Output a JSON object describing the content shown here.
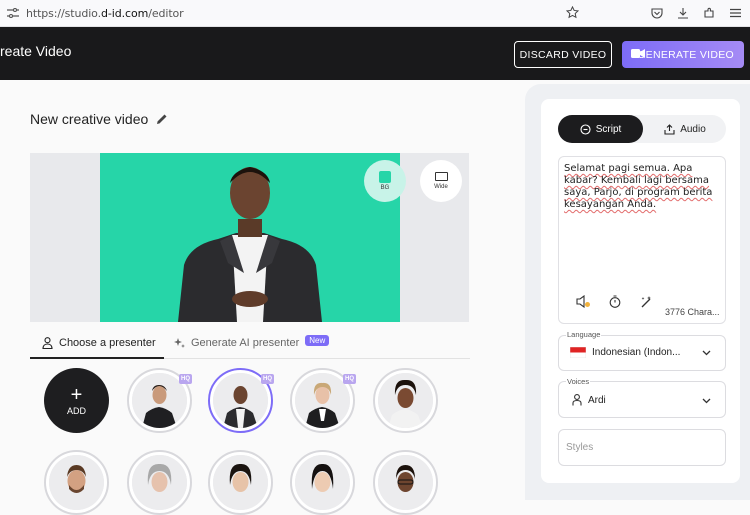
{
  "browser": {
    "url_prefix": "https://studio.",
    "url_host": "d-id.com",
    "url_path": "/editor"
  },
  "header": {
    "title": "reate Video",
    "discard_label": "DISCARD VIDEO",
    "generate_label": "GENERATE VIDEO"
  },
  "editor": {
    "video_title": "New creative video",
    "bg_label": "BG",
    "wide_label": "Wide"
  },
  "presenter_tabs": {
    "choose_label": "Choose a presenter",
    "ai_label": "Generate AI presenter",
    "new_badge": "New"
  },
  "presenters": {
    "add_label": "ADD",
    "hq_label": "HQ"
  },
  "panel": {
    "script_tab": "Script",
    "audio_tab": "Audio",
    "script_text": "Selamat pagi semua. Apa kabar? Kembali lagi bersama saya, Parjo, di program berita kesayangan Anda.",
    "char_count": "3776 Chara...",
    "language_label": "Language",
    "language_value": "Indonesian (Indon...",
    "voices_label": "Voices",
    "voice_value": "Ardi",
    "styles_placeholder": "Styles"
  },
  "colors": {
    "accent": "#7d6cf7",
    "stage_bg": "#26d5a8",
    "header_bg": "#19191b"
  }
}
